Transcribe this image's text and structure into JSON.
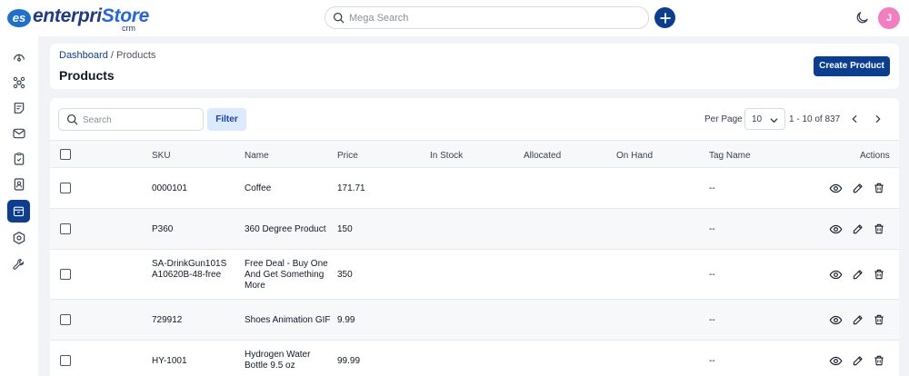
{
  "app": {
    "logo_mark": "es",
    "logo_name_part1": "enterpri",
    "logo_name_part2": "Store",
    "logo_sub": "crm"
  },
  "topbar": {
    "search_placeholder": "Mega Search",
    "avatar_initial": "J"
  },
  "breadcrumb": {
    "root": "Dashboard",
    "separator": " / ",
    "current": "Products"
  },
  "page": {
    "title": "Products",
    "create_label": "Create Product"
  },
  "table_controls": {
    "search_placeholder": "Search",
    "filter_label": "Filter",
    "per_page_label": "Per Page",
    "per_page_value": "10",
    "range_text": "1 - 10 of 837"
  },
  "columns": {
    "sku": "SKU",
    "name": "Name",
    "price": "Price",
    "in_stock": "In Stock",
    "allocated": "Allocated",
    "on_hand": "On Hand",
    "tag_name": "Tag Name",
    "actions": "Actions"
  },
  "rows": [
    {
      "sku": "0000101",
      "name": "Coffee",
      "price": "171.71",
      "tag": "--"
    },
    {
      "sku": "P360",
      "name": "360 Degree Product",
      "price": "150",
      "tag": "--"
    },
    {
      "sku": "SA-DrinkGun101SA10620B-48-free",
      "name": "Free Deal - Buy One And Get Something More",
      "price": "350",
      "tag": "--"
    },
    {
      "sku": "729912",
      "name": "Shoes Animation GIF",
      "price": "9.99",
      "tag": "--"
    },
    {
      "sku": "HY-1001",
      "name": "Hydrogen Water Bottle 9.5 oz",
      "price": "99.99",
      "tag": "--"
    }
  ],
  "colors": {
    "primary": "#0b3d91",
    "avatar": "#f27ec0",
    "filter_bg": "#dbeafe"
  },
  "icons": {
    "sidebar": [
      "dashboard-icon",
      "integrations-icon",
      "orders-icon",
      "mail-icon",
      "clipboard-icon",
      "contacts-icon",
      "products-icon",
      "settings-icon",
      "tools-icon"
    ],
    "row_actions": [
      "eye-icon",
      "edit-icon",
      "trash-icon"
    ]
  }
}
